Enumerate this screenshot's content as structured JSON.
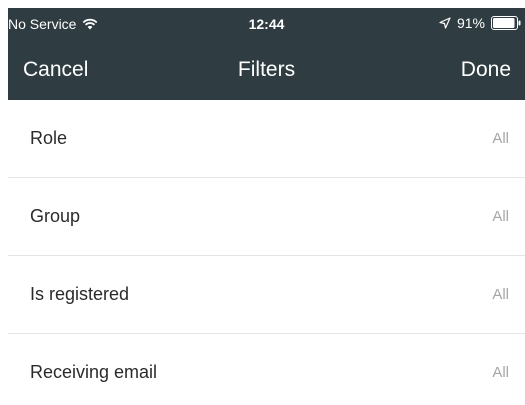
{
  "status_bar": {
    "carrier": "No Service",
    "time": "12:44",
    "battery": "91%",
    "icons": [
      "wifi-icon",
      "location-arrow-icon",
      "battery-icon"
    ]
  },
  "nav": {
    "cancel_label": "Cancel",
    "title": "Filters",
    "done_label": "Done"
  },
  "filters": [
    {
      "label": "Role",
      "value": "All"
    },
    {
      "label": "Group",
      "value": "All"
    },
    {
      "label": "Is registered",
      "value": "All"
    },
    {
      "label": "Receiving email",
      "value": "All"
    }
  ],
  "colors": {
    "header_bg": "#2f3c41",
    "header_text": "#ffffff",
    "row_label": "#2b2b2b",
    "row_value": "#a6a6a6",
    "divider": "#e4e4e4"
  }
}
